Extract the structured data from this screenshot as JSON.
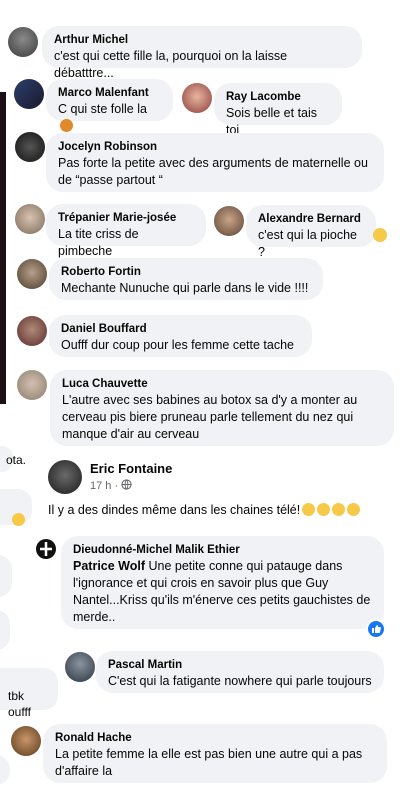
{
  "comments": [
    {
      "name": "Arthur Michel",
      "text": "c'est qui cette fille la, pourquoi on la laisse débatttre..."
    },
    {
      "name": "Marco Malenfant",
      "text": "C qui ste folle la"
    },
    {
      "name": "Ray Lacombe",
      "text": "Sois belle et tais toi"
    },
    {
      "name": "Jocelyn Robinson",
      "text1": "Pas forte la petite avec des arguments de maternelle ou",
      "text2": "de “passe partout “"
    },
    {
      "name": "Trépanier Marie-josée",
      "text": "La tite criss de pimbeche"
    },
    {
      "name": "Alexandre Bernard",
      "text": "c'est qui la pioche ?"
    },
    {
      "name": "Roberto Fortin",
      "text": "Mechante Nunuche qui parle dans le vide !!!!"
    },
    {
      "name": "Daniel Bouffard",
      "text": "Oufff dur coup pour les femme cette tache"
    },
    {
      "name": "Luca Chauvette",
      "text1": "L'autre avec ses babines au botox sa d'y a monter au",
      "text2": "cerveau pis biere pruneau parle tellement du nez qui",
      "text3": "manque d'air au cerveau"
    }
  ],
  "post": {
    "author": "Eric Fontaine",
    "time": "17 h ·",
    "text": "Il y a des dindes même dans les chaines télé!"
  },
  "replies": [
    {
      "name": "Dieudonné-Michel Malik Ethier",
      "mention": "Patrice Wolf",
      "text1": "Une petite conne qui patauge dans",
      "text2": "l'ignorance et qui crois en savoir plus que Guy",
      "text3": "Nantel...Kriss qu'ils m'énerve ces petits gauchistes de",
      "text4": "merde.."
    },
    {
      "name": "Pascal Martin",
      "text": "C'est qui la fatigante nowhere qui parle toujours"
    },
    {
      "name": "Ronald Hache",
      "text1": "La petite femme la elle est pas bien une autre qui a pas",
      "text2": "d'affaire la"
    }
  ],
  "left_fragments": [
    "ota.",
    "tbk oufff"
  ],
  "colors": {
    "bubble": "#f0f2f5",
    "meta": "#65676b",
    "like": "#1877f2"
  },
  "icons": [
    "laughing-emoji-icon",
    "globe-icon",
    "like-reaction-icon",
    "verified-cross-icon"
  ]
}
